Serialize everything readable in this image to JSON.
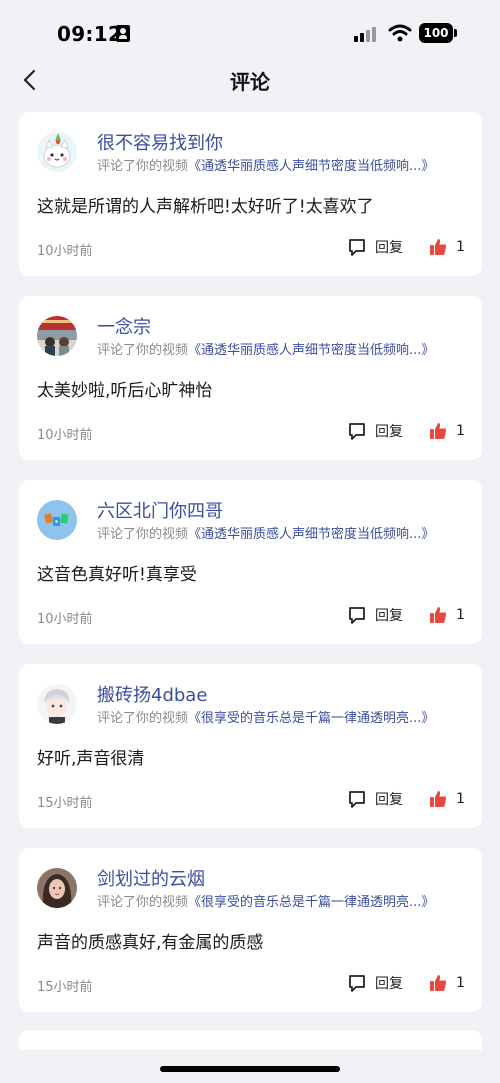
{
  "status_bar": {
    "time": "09:12",
    "battery": "100",
    "icons": [
      "id-card-icon",
      "signal-icon",
      "wifi-icon",
      "battery-icon"
    ]
  },
  "header": {
    "title": "评论",
    "back_icon": "chevron-left-icon"
  },
  "comments": [
    {
      "username": "很不容易找到你",
      "activity_prefix": "评论了你的视频",
      "video_title": "《通透华丽质感人声细节密度当低频响...》",
      "text": "这就是所谓的人声解析吧!太好听了!太喜欢了",
      "time": "10小时前",
      "reply_label": "回复",
      "likes": "1",
      "avatar": "cartoon-cat-avatar"
    },
    {
      "username": "一念宗",
      "activity_prefix": "评论了你的视频",
      "video_title": "《通透华丽质感人声细节密度当低频响...》",
      "text": "太美妙啦,听后心旷神怡",
      "time": "10小时前",
      "reply_label": "回复",
      "likes": "1",
      "avatar": "photo-avatar"
    },
    {
      "username": "六区北门你四哥",
      "activity_prefix": "评论了你的视频",
      "video_title": "《通透华丽质感人声细节密度当低频响...》",
      "text": "这音色真好听!真享受",
      "time": "10小时前",
      "reply_label": "回复",
      "likes": "1",
      "avatar": "blocks-avatar"
    },
    {
      "username": "搬砖扬4dbae",
      "activity_prefix": "评论了你的视频",
      "video_title": "《很享受的音乐总是千篇一律通透明亮...》",
      "text": "好听,声音很清",
      "time": "15小时前",
      "reply_label": "回复",
      "likes": "1",
      "avatar": "anime-avatar"
    },
    {
      "username": "剑划过的云烟",
      "activity_prefix": "评论了你的视频",
      "video_title": "《很享受的音乐总是千篇一律通透明亮...》",
      "text": "声音的质感真好,有金属的质感",
      "time": "15小时前",
      "reply_label": "回复",
      "likes": "1",
      "avatar": "portrait-avatar"
    }
  ],
  "colors": {
    "link": "#3b4ea0",
    "like": "#e8473c",
    "muted": "#8a8a8e",
    "background": "#f2f2f6"
  }
}
